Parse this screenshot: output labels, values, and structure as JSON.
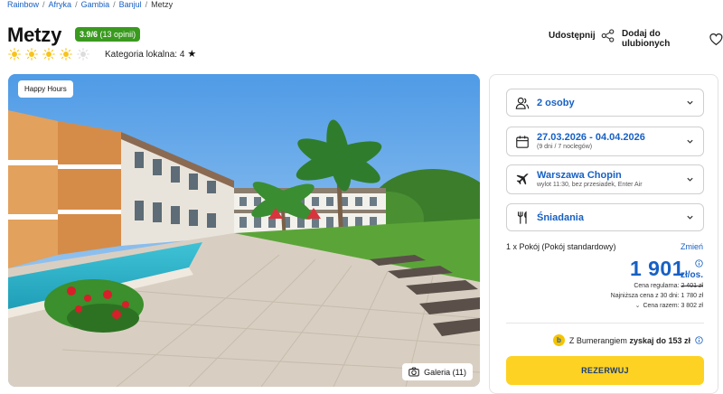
{
  "breadcrumb": {
    "items": [
      "Rainbow",
      "Afryka",
      "Gambia",
      "Banjul"
    ],
    "current": "Metzy"
  },
  "hotel": {
    "name": "Metzy",
    "rating_score": "3.9/6",
    "rating_count": "(13 opinii)",
    "rating_color": "#3a9a1f",
    "suns_filled": 4,
    "suns_total": 5,
    "local_category_label": "Kategoria lokalna: 4",
    "local_category_icon": "star-icon"
  },
  "actions": {
    "share_label": "Udostępnij",
    "share_icon": "share-icon",
    "favorite_label": "Dodaj do ulubionych",
    "favorite_icon": "heart-icon"
  },
  "photo": {
    "badge": "Happy Hours",
    "gallery_label": "Galeria (11)",
    "gallery_icon": "camera-icon"
  },
  "booking": {
    "travelers": {
      "label": "2 osoby",
      "icon": "people-icon"
    },
    "dates": {
      "label": "27.03.2026 - 04.04.2026",
      "sub": "(9 dni / 7 noclegów)",
      "icon": "calendar-icon"
    },
    "flight": {
      "label": "Warszawa Chopin",
      "sub": "wylot 11:30, bez przesiadek, Enter Air",
      "icon": "plane-icon"
    },
    "board": {
      "label": "Śniadania",
      "icon": "cutlery-icon"
    },
    "room": "1 x Pokój  (Pokój standardowy)",
    "change_label": "Zmień",
    "price": "1 901",
    "per_person": "zł/os.",
    "regular_price_label": "Cena regularna:",
    "regular_price": "2 401 zł",
    "lowest_30_days": "Najniższa cena z 30 dni: 1 780 zł",
    "total_label": "Cena razem: 3 802 zł",
    "bumerang_prefix": "Z Bumerangiem",
    "bumerang_bold": "zyskaj do 153 zł",
    "reserve_label": "REZERWUJ",
    "accent_color": "#1760c4",
    "button_color": "#fdd223"
  }
}
